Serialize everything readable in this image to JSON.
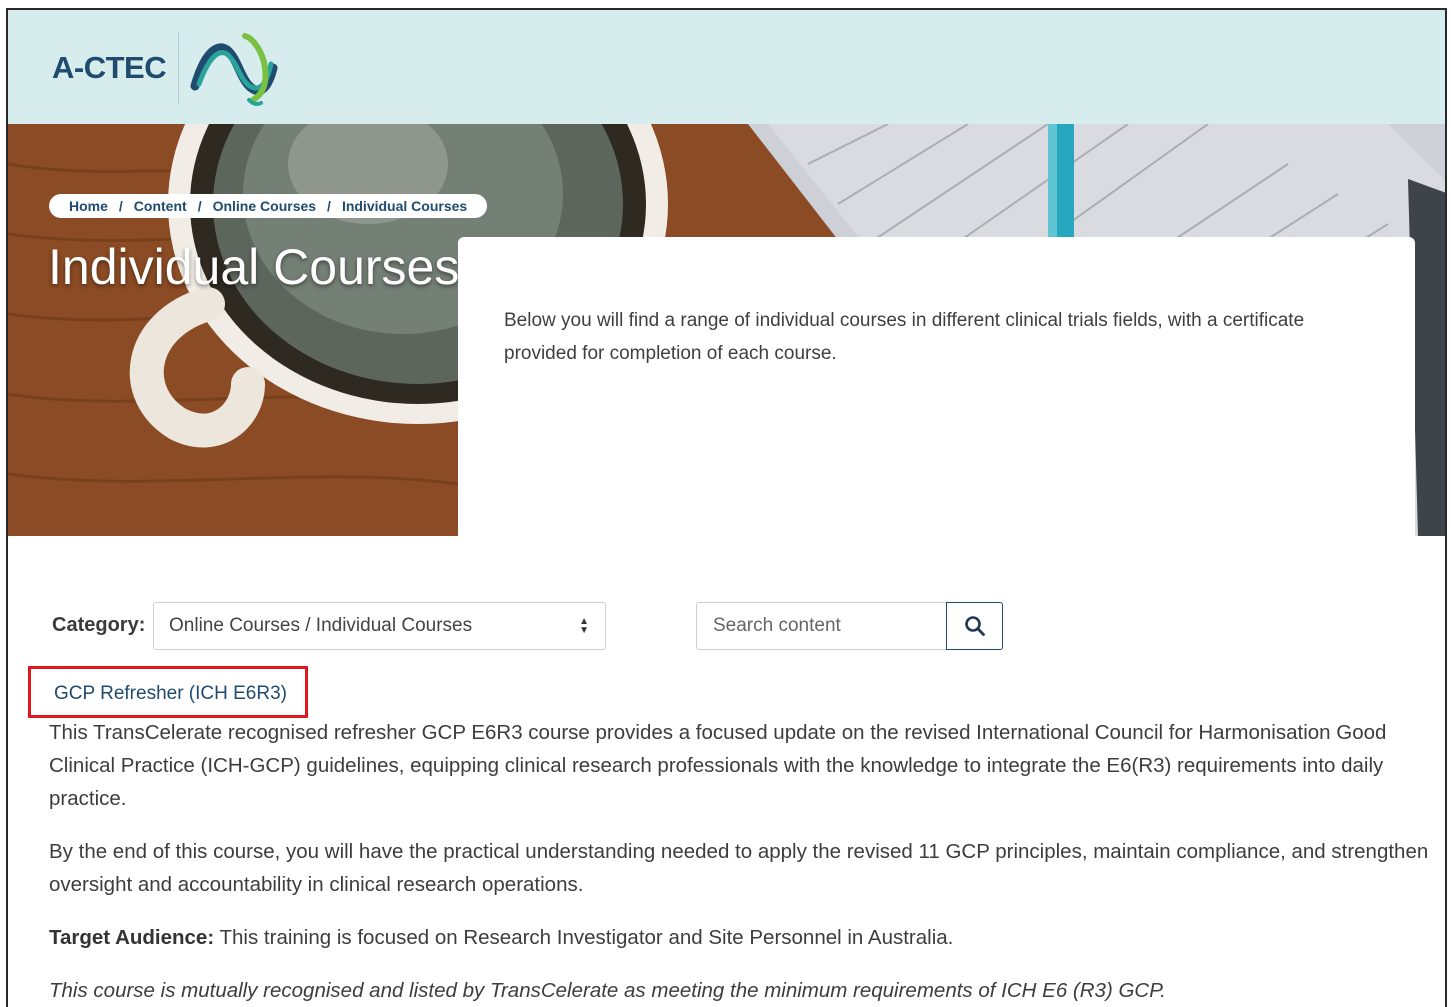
{
  "header": {
    "logo_text": "A-CTEC",
    "brand_colors": {
      "header_bg": "#d7ecec",
      "navy": "#1f4b6e",
      "teal": "#2aa39a",
      "green": "#7ac043"
    }
  },
  "breadcrumb": {
    "items": [
      "Home",
      "Content",
      "Online Courses",
      "Individual Courses"
    ],
    "separator": "/"
  },
  "hero": {
    "title": "Individual Courses"
  },
  "intro": {
    "text": "Below you will find a range of individual courses in different clinical trials fields, with a certificate provided for completion of each course."
  },
  "filters": {
    "category_label": "Category:",
    "category_selected": "Online Courses / Individual Courses",
    "search_placeholder": "Search content",
    "search_icon": "search-icon"
  },
  "course": {
    "title": "GCP Refresher (ICH E6R3)",
    "highlight_color": "#e0181f",
    "paragraph1": "This TransCelerate recognised refresher GCP E6R3 course provides a focused update on the revised International Council for Harmonisation Good Clinical Practice (ICH-GCP) guidelines, equipping clinical research professionals with the knowledge to integrate the E6(R3) requirements into daily practice.",
    "paragraph2": "By the end of this course, you will have the practical understanding needed to apply the revised 11 GCP principles, maintain compliance, and strengthen oversight and accountability in clinical research operations.",
    "audience_label": "Target Audience:",
    "audience_text": " This training is focused on Research Investigator and Site Personnel in Australia.",
    "recognition_note": "This course is mutually recognised and listed by TransCelerate as meeting the minimum requirements of ICH E6 (R3) GCP."
  }
}
